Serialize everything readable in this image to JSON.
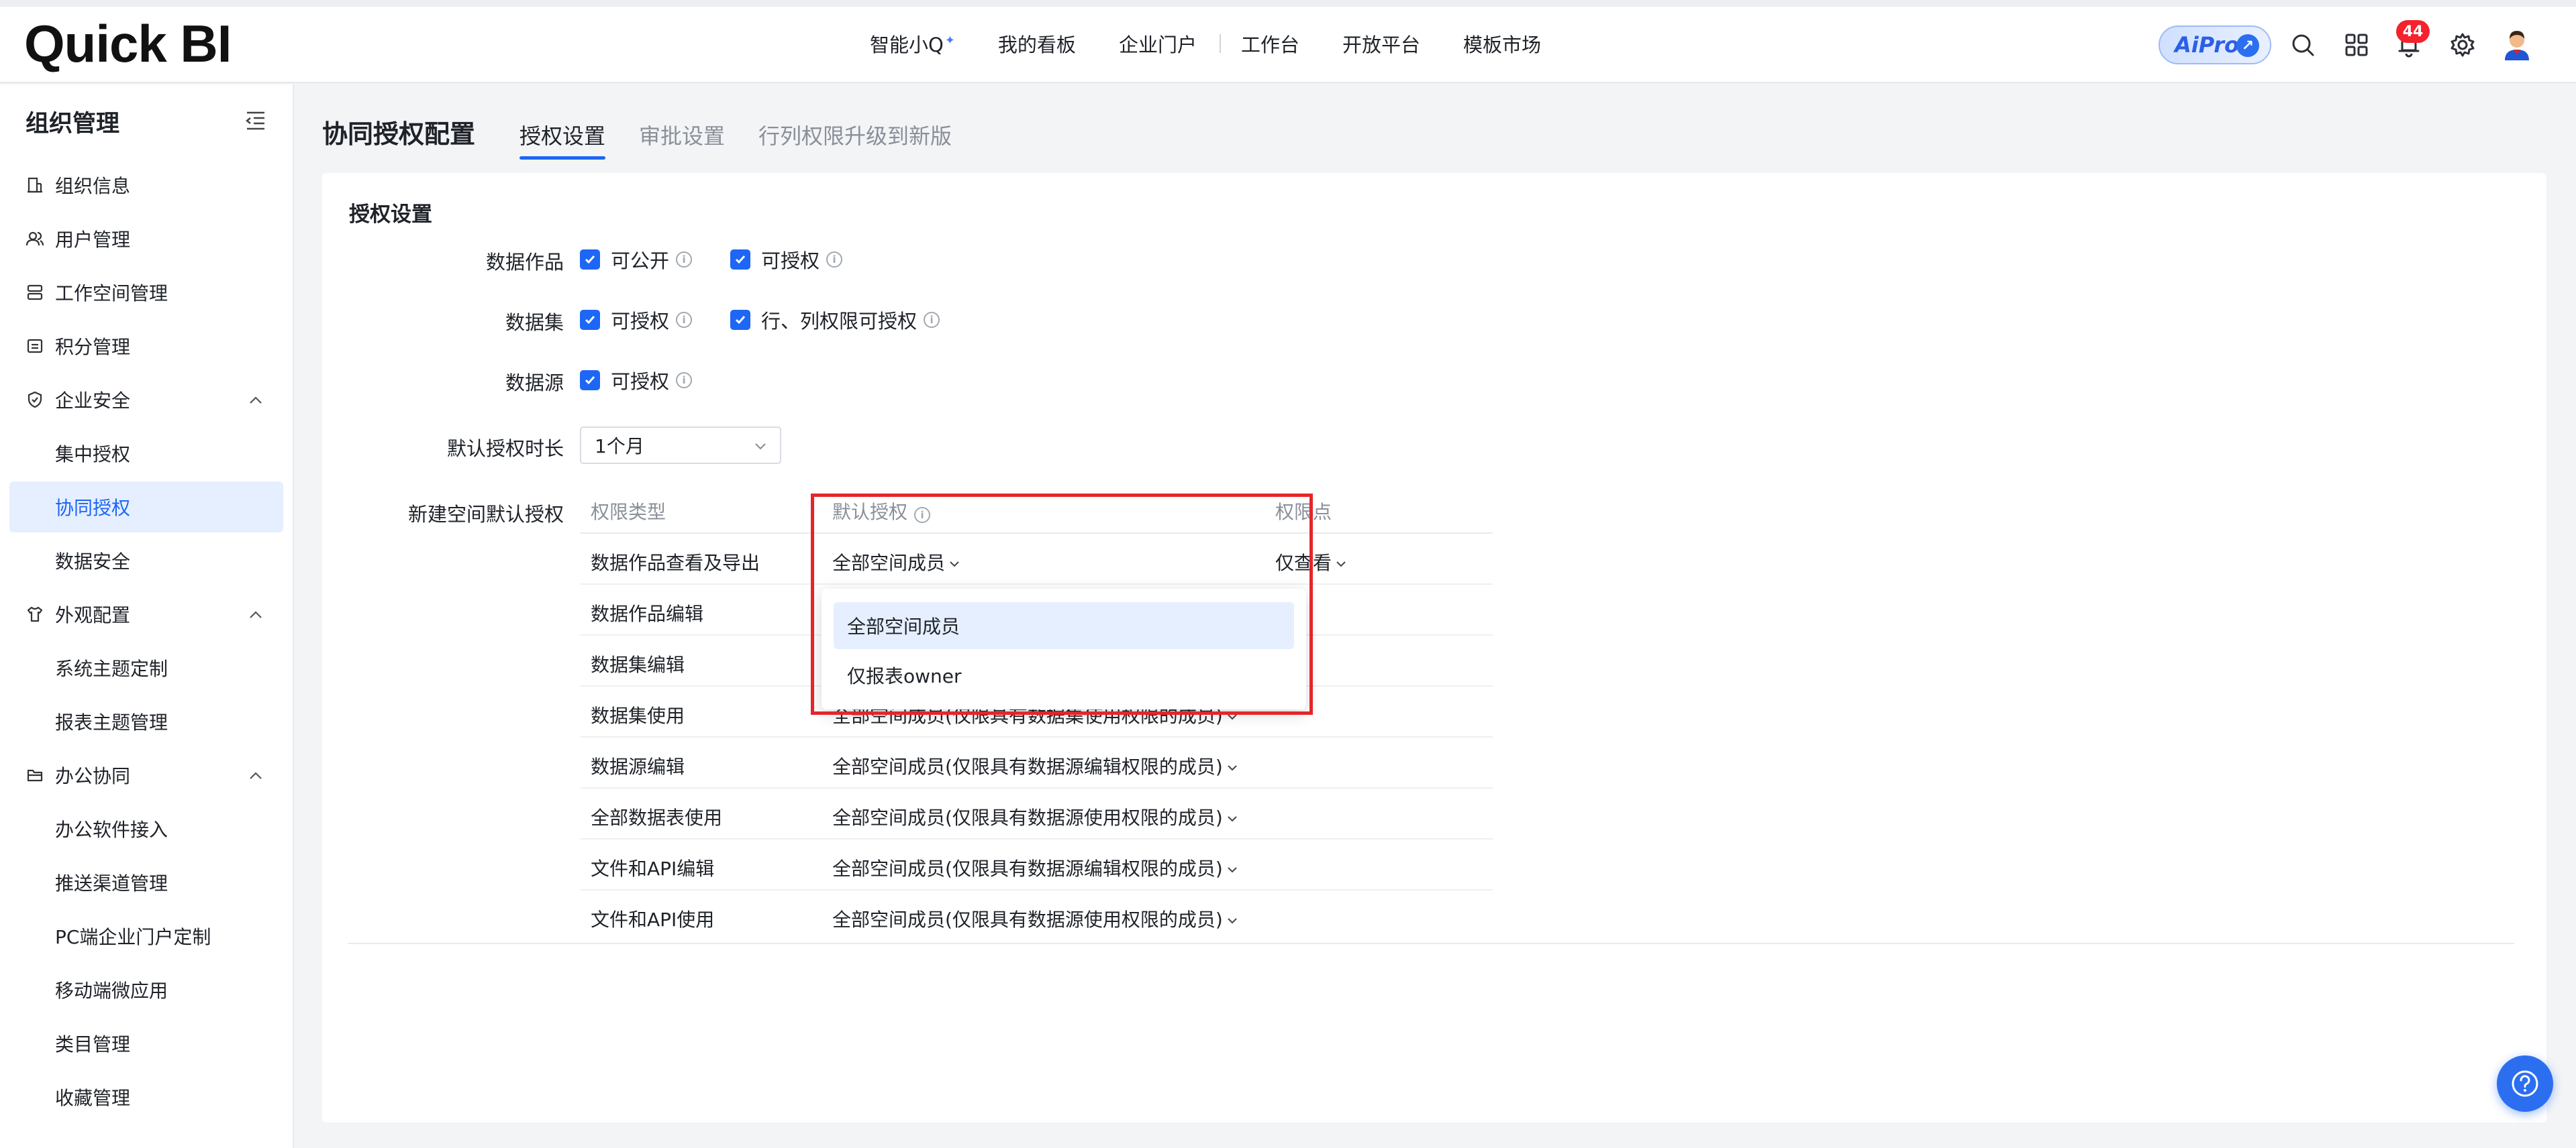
{
  "app": {
    "logo": "Quick BI"
  },
  "topnav": {
    "items": [
      "智能小Q",
      "我的看板",
      "企业门户",
      "工作台",
      "开放平台",
      "模板市场"
    ],
    "ai_pro": "AiPro",
    "notification_count": "44"
  },
  "sidebar": {
    "title": "组织管理",
    "items": [
      {
        "label": "组织信息",
        "icon": "building-icon"
      },
      {
        "label": "用户管理",
        "icon": "users-icon"
      },
      {
        "label": "工作空间管理",
        "icon": "stack-icon"
      },
      {
        "label": "积分管理",
        "icon": "points-icon"
      },
      {
        "label": "企业安全",
        "icon": "shield-icon"
      },
      {
        "label": "集中授权"
      },
      {
        "label": "协同授权"
      },
      {
        "label": "数据安全"
      },
      {
        "label": "外观配置",
        "icon": "shirt-icon"
      },
      {
        "label": "系统主题定制"
      },
      {
        "label": "报表主题管理"
      },
      {
        "label": "办公协同",
        "icon": "folder-icon"
      },
      {
        "label": "办公软件接入"
      },
      {
        "label": "推送渠道管理"
      },
      {
        "label": "PC端企业门户定制"
      },
      {
        "label": "移动端微应用"
      },
      {
        "label": "类目管理"
      },
      {
        "label": "收藏管理"
      }
    ]
  },
  "header": {
    "title": "协同授权配置",
    "tabs": [
      "授权设置",
      "审批设置",
      "行列权限升级到新版"
    ]
  },
  "settings": {
    "section_title": "授权设置",
    "labels": {
      "data_work": "数据作品",
      "dataset": "数据集",
      "datasource": "数据源",
      "duration": "默认授权时长",
      "new_space": "新建空间默认授权"
    },
    "checkboxes": {
      "work_public": "可公开",
      "work_grant": "可授权",
      "dataset_grant": "可授权",
      "dataset_rowcol": "行、列权限可授权",
      "datasource_grant": "可授权"
    },
    "duration_value": "1个月"
  },
  "table": {
    "headers": [
      "权限类型",
      "默认授权",
      "权限点"
    ],
    "rows": [
      {
        "type": "数据作品查看及导出",
        "default": "全部空间成员",
        "point": "仅查看"
      },
      {
        "type": "数据作品编辑",
        "default": "",
        "point": ""
      },
      {
        "type": "数据集编辑",
        "default": "",
        "point": ""
      },
      {
        "type": "数据集使用",
        "default": "全部空间成员(仅限具有数据集使用权限的成员)",
        "point": ""
      },
      {
        "type": "数据源编辑",
        "default": "全部空间成员(仅限具有数据源编辑权限的成员)",
        "point": ""
      },
      {
        "type": "全部数据表使用",
        "default": "全部空间成员(仅限具有数据源使用权限的成员)",
        "point": ""
      },
      {
        "type": "文件和API编辑",
        "default": "全部空间成员(仅限具有数据源编辑权限的成员)",
        "point": ""
      },
      {
        "type": "文件和API使用",
        "default": "全部空间成员(仅限具有数据源使用权限的成员)",
        "point": ""
      }
    ]
  },
  "dropdown": {
    "options": [
      "全部空间成员",
      "仅报表owner"
    ],
    "selected": "全部空间成员"
  },
  "colors": {
    "accent": "#1e66f5",
    "highlight_frame": "#e5252a"
  }
}
